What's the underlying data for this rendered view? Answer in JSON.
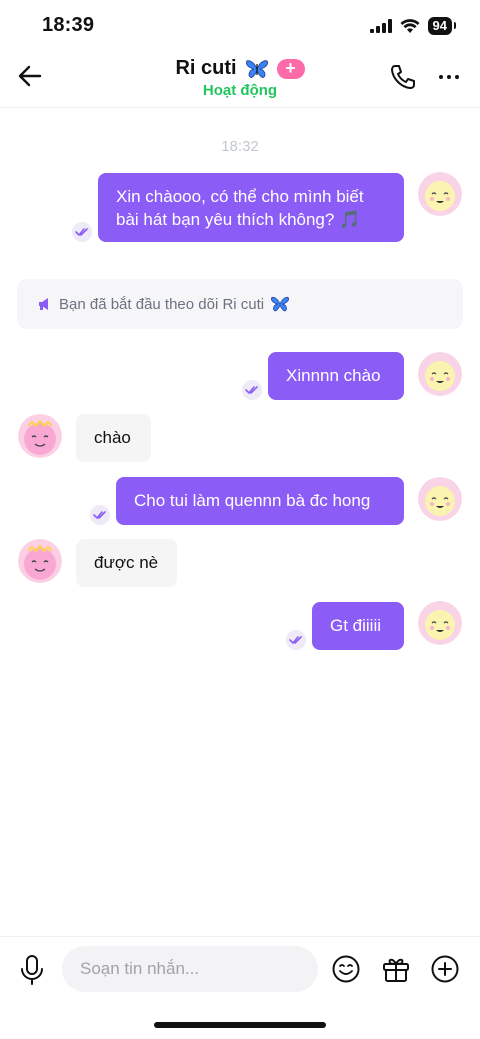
{
  "status_bar": {
    "time": "18:39",
    "battery": "94"
  },
  "header": {
    "contact_name": "Ri cuti",
    "presence": "Hoạt động",
    "presence_color": "#22c55e",
    "plus_label": "+"
  },
  "chat": {
    "timestamp": "18:32",
    "system_note": "Bạn đã bắt đầu theo dõi Ri cuti",
    "messages": [
      {
        "direction": "out",
        "text_line1": "Xin chàooo, có thể cho mình biết",
        "text_line2": "bài hát bạn yêu thích không? 🎵"
      },
      {
        "direction": "out",
        "text": "Xinnnn chào"
      },
      {
        "direction": "in",
        "text": "chào"
      },
      {
        "direction": "out",
        "text": "Cho tui làm quennn bà đc hong"
      },
      {
        "direction": "in",
        "text": "được nè"
      },
      {
        "direction": "out",
        "text": "Gt điiiii"
      }
    ]
  },
  "composer": {
    "placeholder": "Soạn tin nhắn..."
  },
  "colors": {
    "accent": "#8b5cf6",
    "badge": "#ff6aa8",
    "incoming_bubble": "#f5f5f6"
  },
  "icons": [
    "back-arrow-icon",
    "butterfly-icon",
    "phone-icon",
    "more-icon",
    "seen-icon",
    "megaphone-icon",
    "microphone-icon",
    "emoji-icon",
    "gift-icon",
    "add-icon"
  ]
}
